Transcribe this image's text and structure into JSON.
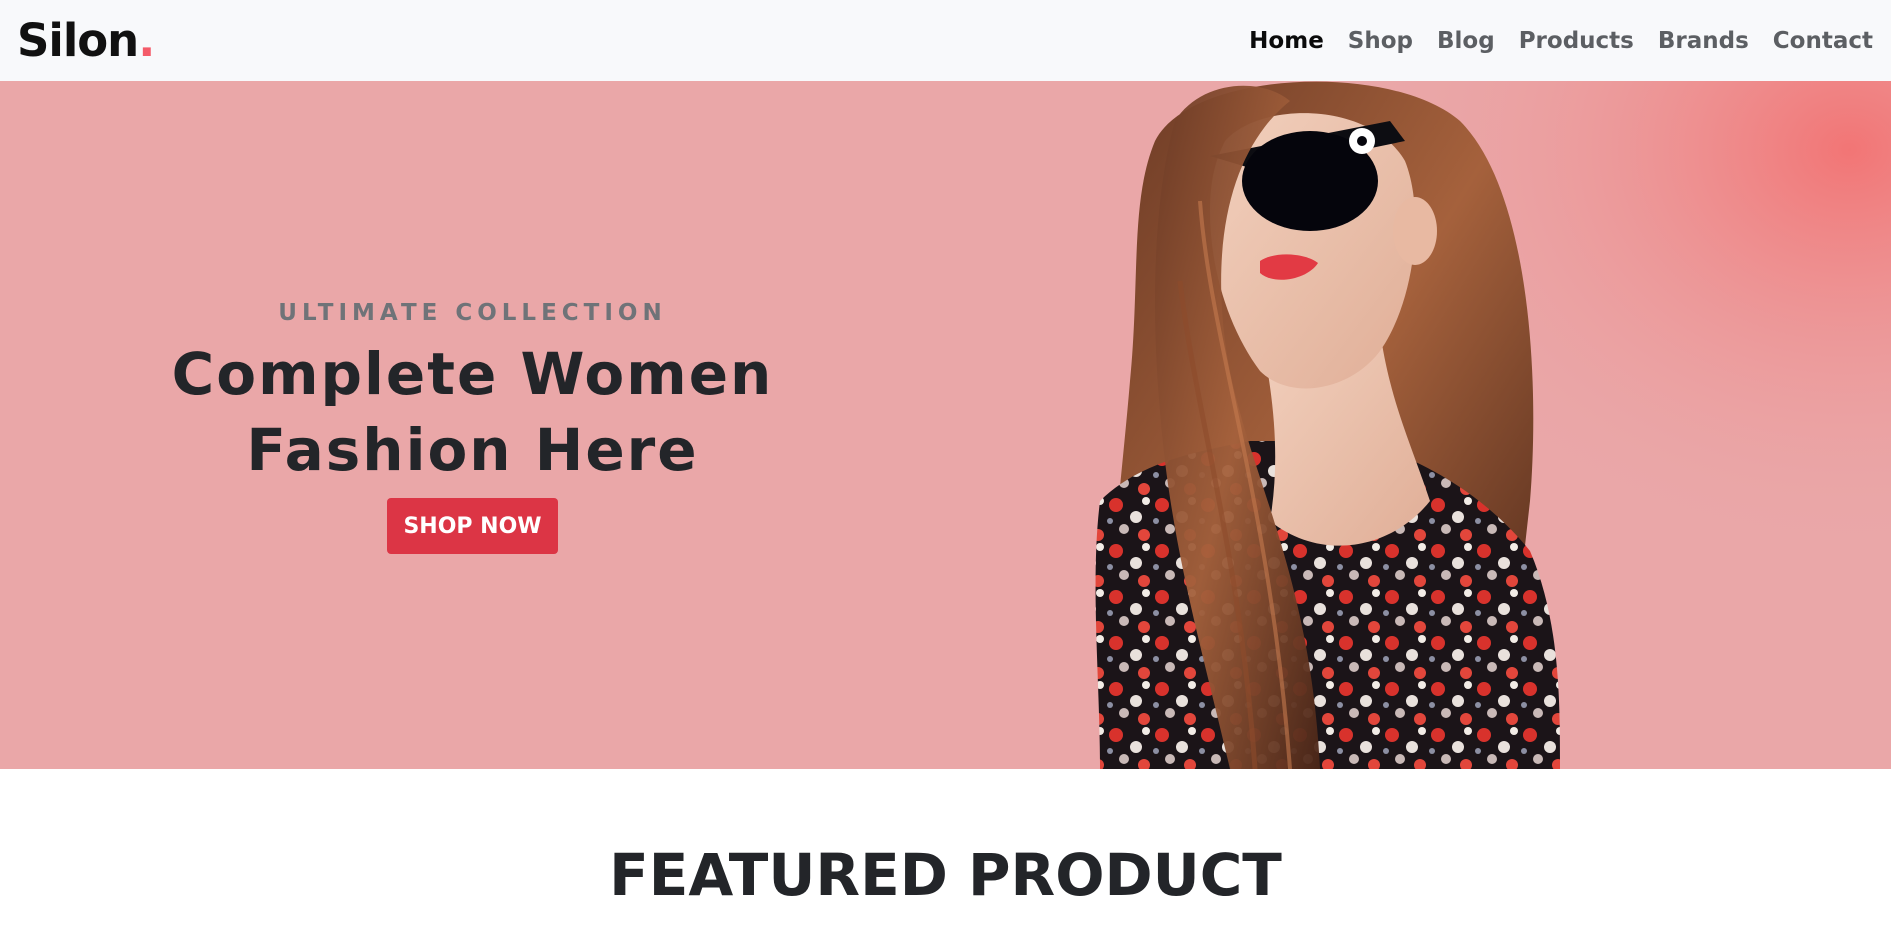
{
  "navbar": {
    "brand_name": "Silon",
    "brand_dot": ".",
    "links": [
      {
        "label": "Home",
        "active": true
      },
      {
        "label": "Shop"
      },
      {
        "label": "Blog"
      },
      {
        "label": "Products"
      },
      {
        "label": "Brands"
      },
      {
        "label": "Contact"
      }
    ]
  },
  "hero": {
    "kicker": "ULTIMATE COLLECTION",
    "title": "Complete Women Fashion Here",
    "cta_label": "SHOP NOW",
    "background_color": "#eaa7a8",
    "accent_color": "#dc3545"
  },
  "featured": {
    "title": "FEATURED PRODUCT"
  }
}
